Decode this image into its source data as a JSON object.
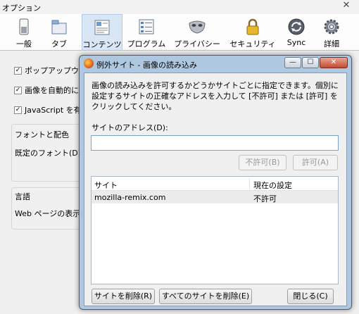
{
  "window": {
    "title": "オプション",
    "close_glyph": "✕"
  },
  "toolbar": {
    "tabs": [
      {
        "label": "一般",
        "icon": "switch-icon"
      },
      {
        "label": "タブ",
        "icon": "tab-window-icon"
      },
      {
        "label": "コンテンツ",
        "icon": "content-page-icon",
        "selected": true
      },
      {
        "label": "プログラム",
        "icon": "program-list-icon"
      },
      {
        "label": "プライバシー",
        "icon": "mask-icon"
      },
      {
        "label": "セキュリティ",
        "icon": "padlock-icon"
      },
      {
        "label": "Sync",
        "icon": "sync-icon"
      },
      {
        "label": "詳細",
        "icon": "gear-icon"
      }
    ]
  },
  "content": {
    "popup_label": "ポップアップウ",
    "images_label": "画像を自動的に",
    "javascript_label": "JavaScript を有",
    "fonts_group_title": "フォントと配色",
    "default_font_label": "既定のフォント(D):",
    "language_group_title": "言語",
    "webpage_display_label": "Web ページの表示("
  },
  "dialog": {
    "title": "例外サイト - 画像の読み込み",
    "description": "画像の読み込みを許可するかどうかサイトごとに指定できます。個別に設定するサイトの正確なアドレスを入力して [不許可] または [許可] をクリックしてください。",
    "address_label": "サイトのアドレス(D):",
    "address_value": "",
    "block_button": "不許可(B)",
    "allow_button": "許可(A)",
    "list": {
      "headers": [
        "サイト",
        "現在の設定"
      ],
      "rows": [
        {
          "site": "mozilla-remix.com",
          "status": "不許可"
        }
      ]
    },
    "remove_site_button": "サイトを削除(R)",
    "remove_all_button": "すべてのサイトを削除(E)",
    "close_button": "閉じる(C)",
    "window_buttons": {
      "minimize": "—",
      "maximize": "☐",
      "close": "✕"
    }
  },
  "colors": {
    "accent": "#d9e6f6",
    "dialog_frame": "#a8c4e0",
    "close_red": "#c44a2f"
  }
}
